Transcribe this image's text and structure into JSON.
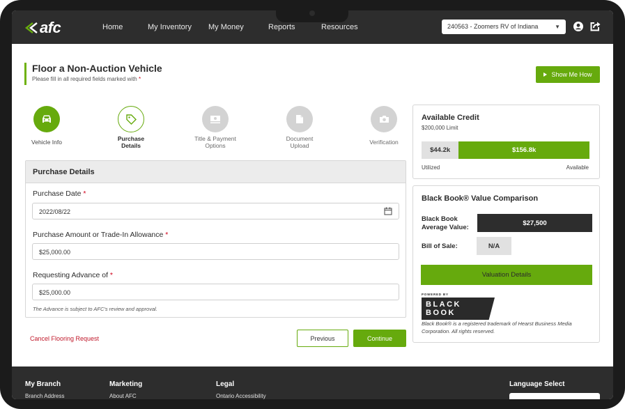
{
  "colors": {
    "accent": "#66aa0d",
    "nav_bg": "#2d2d2d",
    "required": "#d0021b"
  },
  "nav": {
    "links": [
      "Home",
      "My Inventory",
      "My Money",
      "Reports",
      "Resources"
    ],
    "dealer_select": "240563 - Zoomers RV of Indiana",
    "icons": [
      "user-icon",
      "logout-icon"
    ]
  },
  "header": {
    "title": "Floor a Non-Auction Vehicle",
    "subtitle": "Please fill in all required fields marked with",
    "required_mark": "*",
    "show_me_how": "Show Me How"
  },
  "steps": [
    {
      "label": "Vehicle Info",
      "status": "complete",
      "icon": "car-icon"
    },
    {
      "label": "Purchase Details",
      "status": "current",
      "icon": "tag-icon"
    },
    {
      "label": "Title & Payment Options",
      "status": "pending",
      "icon": "money-icon"
    },
    {
      "label": "Document Upload",
      "status": "pending",
      "icon": "document-icon"
    },
    {
      "label": "Verification",
      "status": "pending",
      "icon": "camera-icon"
    }
  ],
  "form": {
    "section_title": "Purchase Details",
    "purchase_date_label": "Purchase Date",
    "purchase_date_value": "2022/08/22",
    "purchase_amount_label": "Purchase Amount or Trade-In Allowance",
    "purchase_amount_value": "$25,000.00",
    "advance_label": "Requesting Advance of",
    "advance_value": "$25,000.00",
    "hint": "The Advance is subject to AFC's review and approval.",
    "required_mark": "*"
  },
  "actions": {
    "cancel": "Cancel Flooring Request",
    "previous": "Previous",
    "continue": "Continue"
  },
  "credit": {
    "title": "Available Credit",
    "limit": "$200,000 Limit",
    "utilized_value": "$44.2k",
    "available_value": "$156.8k",
    "utilized_fraction": 0.221,
    "utilized_label": "Utilized",
    "available_label": "Available"
  },
  "blackbook": {
    "title": "Black Book® Value Comparison",
    "avg_label_1": "Black Book",
    "avg_label_2": "Average Value:",
    "avg_value": "$27,500",
    "bos_label": "Bill of Sale:",
    "bos_value": "N/A",
    "valuation_button": "Valuation Details",
    "powered_by": "POWERED BY",
    "logo_text": "BLACK BOOK",
    "trademark": "Black Book® is a registered trademark of Hearst Business Media Corporation. All rights reserved."
  },
  "footer": {
    "my_branch": "My Branch",
    "branch_address": "Branch Address",
    "marketing": "Marketing",
    "about_afc": "About AFC",
    "legal": "Legal",
    "ontario": "Ontario Accessibility",
    "language": "Language Select"
  }
}
